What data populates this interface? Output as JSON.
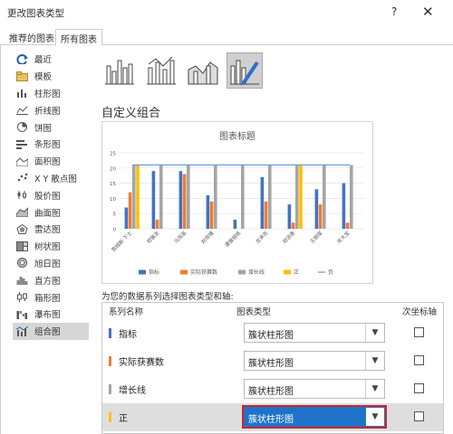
{
  "window": {
    "title": "更改图表类型",
    "help_icon": "?",
    "close_icon": "✕"
  },
  "tabs": [
    {
      "label": "推荐的图表"
    },
    {
      "label": "所有图表"
    }
  ],
  "sidebar": {
    "items": [
      {
        "label": "最近",
        "icon": "recent-icon"
      },
      {
        "label": "模板",
        "icon": "folder-icon"
      },
      {
        "label": "柱形图",
        "icon": "column-chart-icon"
      },
      {
        "label": "折线图",
        "icon": "line-chart-icon"
      },
      {
        "label": "饼图",
        "icon": "pie-chart-icon"
      },
      {
        "label": "条形图",
        "icon": "bar-chart-icon"
      },
      {
        "label": "面积图",
        "icon": "area-chart-icon"
      },
      {
        "label": "X Y 散点图",
        "icon": "scatter-chart-icon"
      },
      {
        "label": "股价图",
        "icon": "stock-chart-icon"
      },
      {
        "label": "曲面图",
        "icon": "surface-chart-icon"
      },
      {
        "label": "雷达图",
        "icon": "radar-chart-icon"
      },
      {
        "label": "树状图",
        "icon": "treemap-icon"
      },
      {
        "label": "旭日图",
        "icon": "sunburst-icon"
      },
      {
        "label": "直方图",
        "icon": "histogram-icon"
      },
      {
        "label": "箱形图",
        "icon": "box-whisker-icon"
      },
      {
        "label": "瀑布图",
        "icon": "waterfall-icon"
      },
      {
        "label": "组合图",
        "icon": "combo-chart-icon"
      }
    ],
    "selected": "组合图"
  },
  "section_title": "自定义组合",
  "series_prompt": "为您的数据系列选择图表类型和轴:",
  "grid": {
    "headers": {
      "name": "系列名称",
      "type": "图表类型",
      "secondary": "次坐标轴"
    },
    "rows": [
      {
        "name": "指标",
        "color": "#4472c4",
        "type": "簇状柱形图",
        "secondary": false
      },
      {
        "name": "实际获赛数",
        "color": "#ed7d31",
        "type": "簇状柱形图",
        "secondary": false
      },
      {
        "name": "增长线",
        "color": "#a5a5a5",
        "type": "簇状柱形图",
        "secondary": false
      },
      {
        "name": "正",
        "color": "#ffc000",
        "type": "簇状柱形图",
        "secondary": false
      }
    ]
  },
  "chart_data": {
    "type": "bar",
    "title": "图表标题",
    "categories": [
      "詹姆斯·下士",
      "郑雅龙",
      "马凤英",
      "赵铁锤",
      "谭雅钢铁",
      "龙承员",
      "郑添勇",
      "王钢蛋",
      "宋大宝"
    ],
    "ylim": [
      0,
      25
    ],
    "yticks": [
      0,
      5,
      10,
      15,
      20,
      25
    ],
    "grid": true,
    "legend_position": "bottom",
    "series": [
      {
        "name": "指标",
        "color": "#4472c4",
        "values": [
          7,
          19,
          19,
          11,
          3,
          17,
          8,
          13,
          15
        ]
      },
      {
        "name": "实际获赛数",
        "color": "#ed7d31",
        "values": [
          12,
          3,
          18,
          9,
          0,
          9,
          2,
          8,
          2
        ]
      },
      {
        "name": "增长线",
        "color": "#a5a5a5",
        "values": [
          21,
          21,
          21,
          21,
          21,
          21,
          21,
          21,
          21
        ]
      },
      {
        "name": "正",
        "color": "#ffc000",
        "values": [
          21,
          0,
          0,
          0,
          0,
          0,
          21,
          0,
          0
        ]
      },
      {
        "name": "负",
        "color": "#5b9bd5",
        "type": "line",
        "values": [
          21,
          21,
          21,
          21,
          21,
          21,
          21,
          21,
          21
        ]
      }
    ]
  }
}
